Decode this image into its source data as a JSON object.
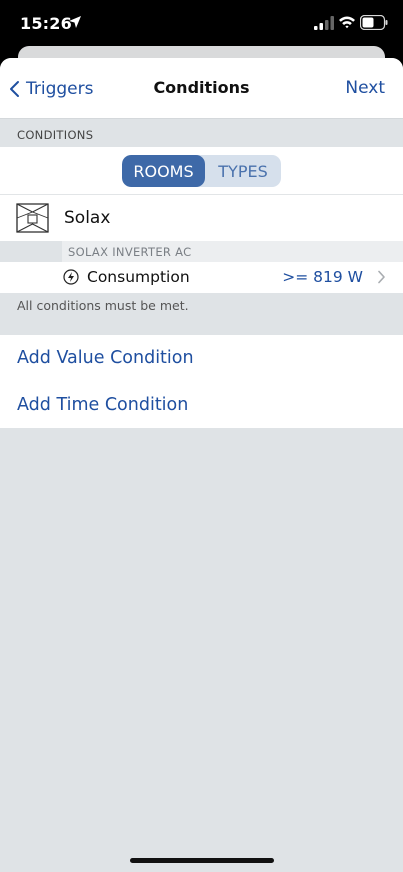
{
  "status_bar": {
    "time": "15:26",
    "icons": [
      "location-arrow-icon",
      "cellular-signal-icon",
      "wifi-icon",
      "battery-icon"
    ]
  },
  "navbar": {
    "back_label": "Triggers",
    "title": "Conditions",
    "next_label": "Next"
  },
  "section": {
    "header": "CONDITIONS",
    "segments": [
      {
        "label": "ROOMS",
        "selected": true
      },
      {
        "label": "TYPES",
        "selected": false
      }
    ]
  },
  "device": {
    "icon": "inverter-icon",
    "name": "Solax",
    "group_header": "SOLAX INVERTER AC",
    "condition": {
      "icon": "lightning-icon",
      "label": "Consumption",
      "value": ">= 819 W"
    }
  },
  "footer_note": "All conditions must be met.",
  "actions": [
    {
      "label": "Add Value Condition"
    },
    {
      "label": "Add Time Condition"
    }
  ],
  "colors": {
    "accent": "#1f4fa0",
    "segment_active": "#3e69a8",
    "segment_bg": "#d6e0ec",
    "background": "#dfe3e6"
  }
}
